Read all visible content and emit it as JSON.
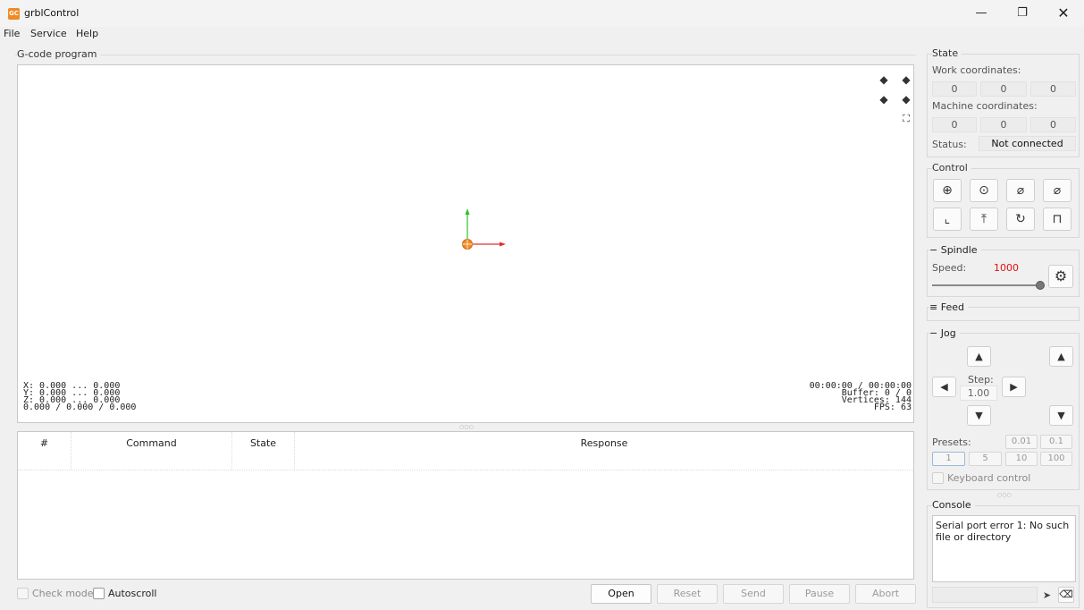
{
  "window": {
    "title": "grblControl",
    "icon_text": "GC",
    "minimize": "—",
    "maximize": "❐",
    "close": "✕"
  },
  "menu": {
    "file": "File",
    "service": "Service",
    "help": "Help"
  },
  "program": {
    "title": "G-code program",
    "coords": "X: 0.000 ... 0.000\nY: 0.000 ... 0.000\nZ: 0.000 ... 0.000\n0.000 / 0.000 / 0.000",
    "stats": "00:00:00 / 00:00:00\nBuffer: 0 / 0\nVertices: 144\nFPS: 63",
    "table_headers": [
      "#",
      "Command",
      "State",
      "Response"
    ],
    "check_mode": "Check mode",
    "autoscroll": "Autoscroll",
    "buttons": {
      "open": "Open",
      "reset": "Reset",
      "send": "Send",
      "pause": "Pause",
      "abort": "Abort"
    }
  },
  "state": {
    "title": "State",
    "work_label": "Work coordinates:",
    "work": [
      "0",
      "0",
      "0"
    ],
    "machine_label": "Machine coordinates:",
    "machine": [
      "0",
      "0",
      "0"
    ],
    "status_label": "Status:",
    "status_value": "Not connected"
  },
  "control": {
    "title": "Control"
  },
  "spindle": {
    "title": "Spindle",
    "collapse_glyph": "−",
    "speed_label": "Speed:",
    "speed_value": "1000",
    "speed_fraction": 1.0,
    "speed_color": "#e01010"
  },
  "feed": {
    "title": "Feed",
    "collapse_glyph": "≡"
  },
  "jog": {
    "title": "Jog",
    "collapse_glyph": "−",
    "step_label": "Step:",
    "step_value": "1.00",
    "presets_label": "Presets:",
    "presets": [
      "0.01",
      "0.1",
      "1",
      "5",
      "10",
      "100"
    ],
    "keyboard_control": "Keyboard control"
  },
  "console": {
    "title": "Console",
    "text": "Serial port error 1: No such file or directory"
  },
  "colors": {
    "x_axis": "#e03030",
    "y_axis": "#30c030",
    "origin": "#f08a24"
  }
}
